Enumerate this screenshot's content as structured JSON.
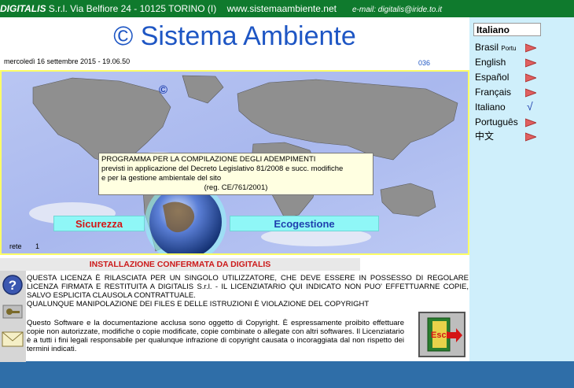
{
  "topbar": {
    "brand": "DIGITALIS",
    "address": " S.r.l. Via Belfiore 24 - 10125 TORINO (I)",
    "website": "www.sistemaambiente.net",
    "email": "e-mail: digitalis@iride.to.it"
  },
  "header": {
    "title": "© Sistema Ambiente",
    "datetime": "mercoledì 16 settembre 2015 - 19.06.50",
    "counter": "036"
  },
  "map": {
    "copyright_symbol": "©",
    "tooltip": {
      "line1": "PROGRAMMA PER LA COMPILAZIONE DEGLI ADEMPIMENTI",
      "line2": "previsti in applicazione del Decreto Legislativo 81/2008 e succ. modifiche",
      "line3": "e per la gestione ambientale del sito",
      "line4": "(reg. CE/761/2001)"
    },
    "btn_sicurezza": "Sicurezza",
    "btn_ecogestione": "Ecogestione",
    "rete_label": "rete",
    "rete_value": "1"
  },
  "install": {
    "header": "INSTALLAZIONE CONFERMATA DA DIGITALIS",
    "license_p1": "QUESTA LICENZA È RILASCIATA PER UN SINGOLO UTILIZZATORE, CHE DEVE ESSERE IN POSSESSO DI REGOLARE LICENZA FIRMATA E RESTITUITA A DIGITALIS S.r.l. - IL LICENZIATARIO QUI INDICATO NON PUO' EFFETTUARNE COPIE, SALVO ESPLICITA CLAUSOLA CONTRATTUALE.",
    "license_p2": "QUALUNQUE MANIPOLAZIONE DEI FILES E DELLE ISTRUZIONI È VIOLAZIONE DEL COPYRIGHT",
    "copyright_text": "Questo Software e la documentazione acclusa sono oggetto di Copyright. È espressamente proibito effettuare copie non autorizzate, modifiche o copie modificate, copie combinate o allegate con altri softwares.   Il Licenziatario è a tutti i fini legali responsabile per qualunque infrazione di copyright causata o incoraggiata dal non rispetto dei termini indicati."
  },
  "esci_label": "Esci",
  "languages": {
    "selected": "Italiano",
    "items": [
      {
        "label": "Brasil",
        "tag": "Portu"
      },
      {
        "label": "English"
      },
      {
        "label": "Español"
      },
      {
        "label": "Français"
      },
      {
        "label": "Italiano"
      },
      {
        "label": "Português"
      },
      {
        "label": "中文"
      }
    ]
  },
  "colors": {
    "topbar": "#0f7a2d",
    "title_blue": "#1e56c4",
    "button_cyan": "#8ff7f7",
    "install_red": "#cc1a1a",
    "right_panel": "#cfeffb",
    "bottom_bar": "#2f6ea8"
  }
}
